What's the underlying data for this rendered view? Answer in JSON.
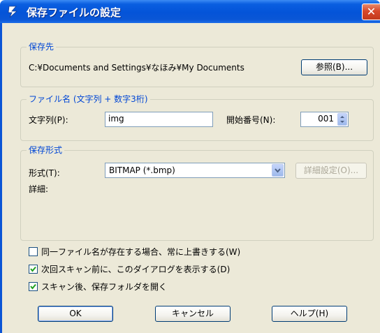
{
  "window": {
    "title": "保存ファイルの設定",
    "close_glyph": "✕"
  },
  "destination": {
    "group_label": "保存先",
    "path": "C:¥Documents and Settings¥なほみ¥My Documents",
    "browse_button": "参照(B)..."
  },
  "filename": {
    "group_label": "ファイル名 (文字列 + 数字3桁)",
    "prefix_label": "文字列(P):",
    "prefix_value": "img",
    "start_number_label": "開始番号(N):",
    "start_number_value": "001"
  },
  "format": {
    "group_label": "保存形式",
    "type_label": "形式(T):",
    "type_value": "BITMAP (*.bmp)",
    "details_button": "詳細設定(O)...",
    "details_label": "詳細:"
  },
  "options": [
    {
      "label": "同一ファイル名が存在する場合、常に上書きする(W)",
      "checked": false
    },
    {
      "label": "次回スキャン前に、このダイアログを表示する(D)",
      "checked": true
    },
    {
      "label": "スキャン後、保存フォルダを開く",
      "checked": true
    }
  ],
  "buttons": {
    "ok": "OK",
    "cancel": "キャンセル",
    "help": "ヘルプ(H)"
  },
  "colors": {
    "title_bar": "#0454d8",
    "group_label": "#0046d5",
    "dialog_bg": "#ece9d8",
    "close_button": "#d8482a"
  }
}
